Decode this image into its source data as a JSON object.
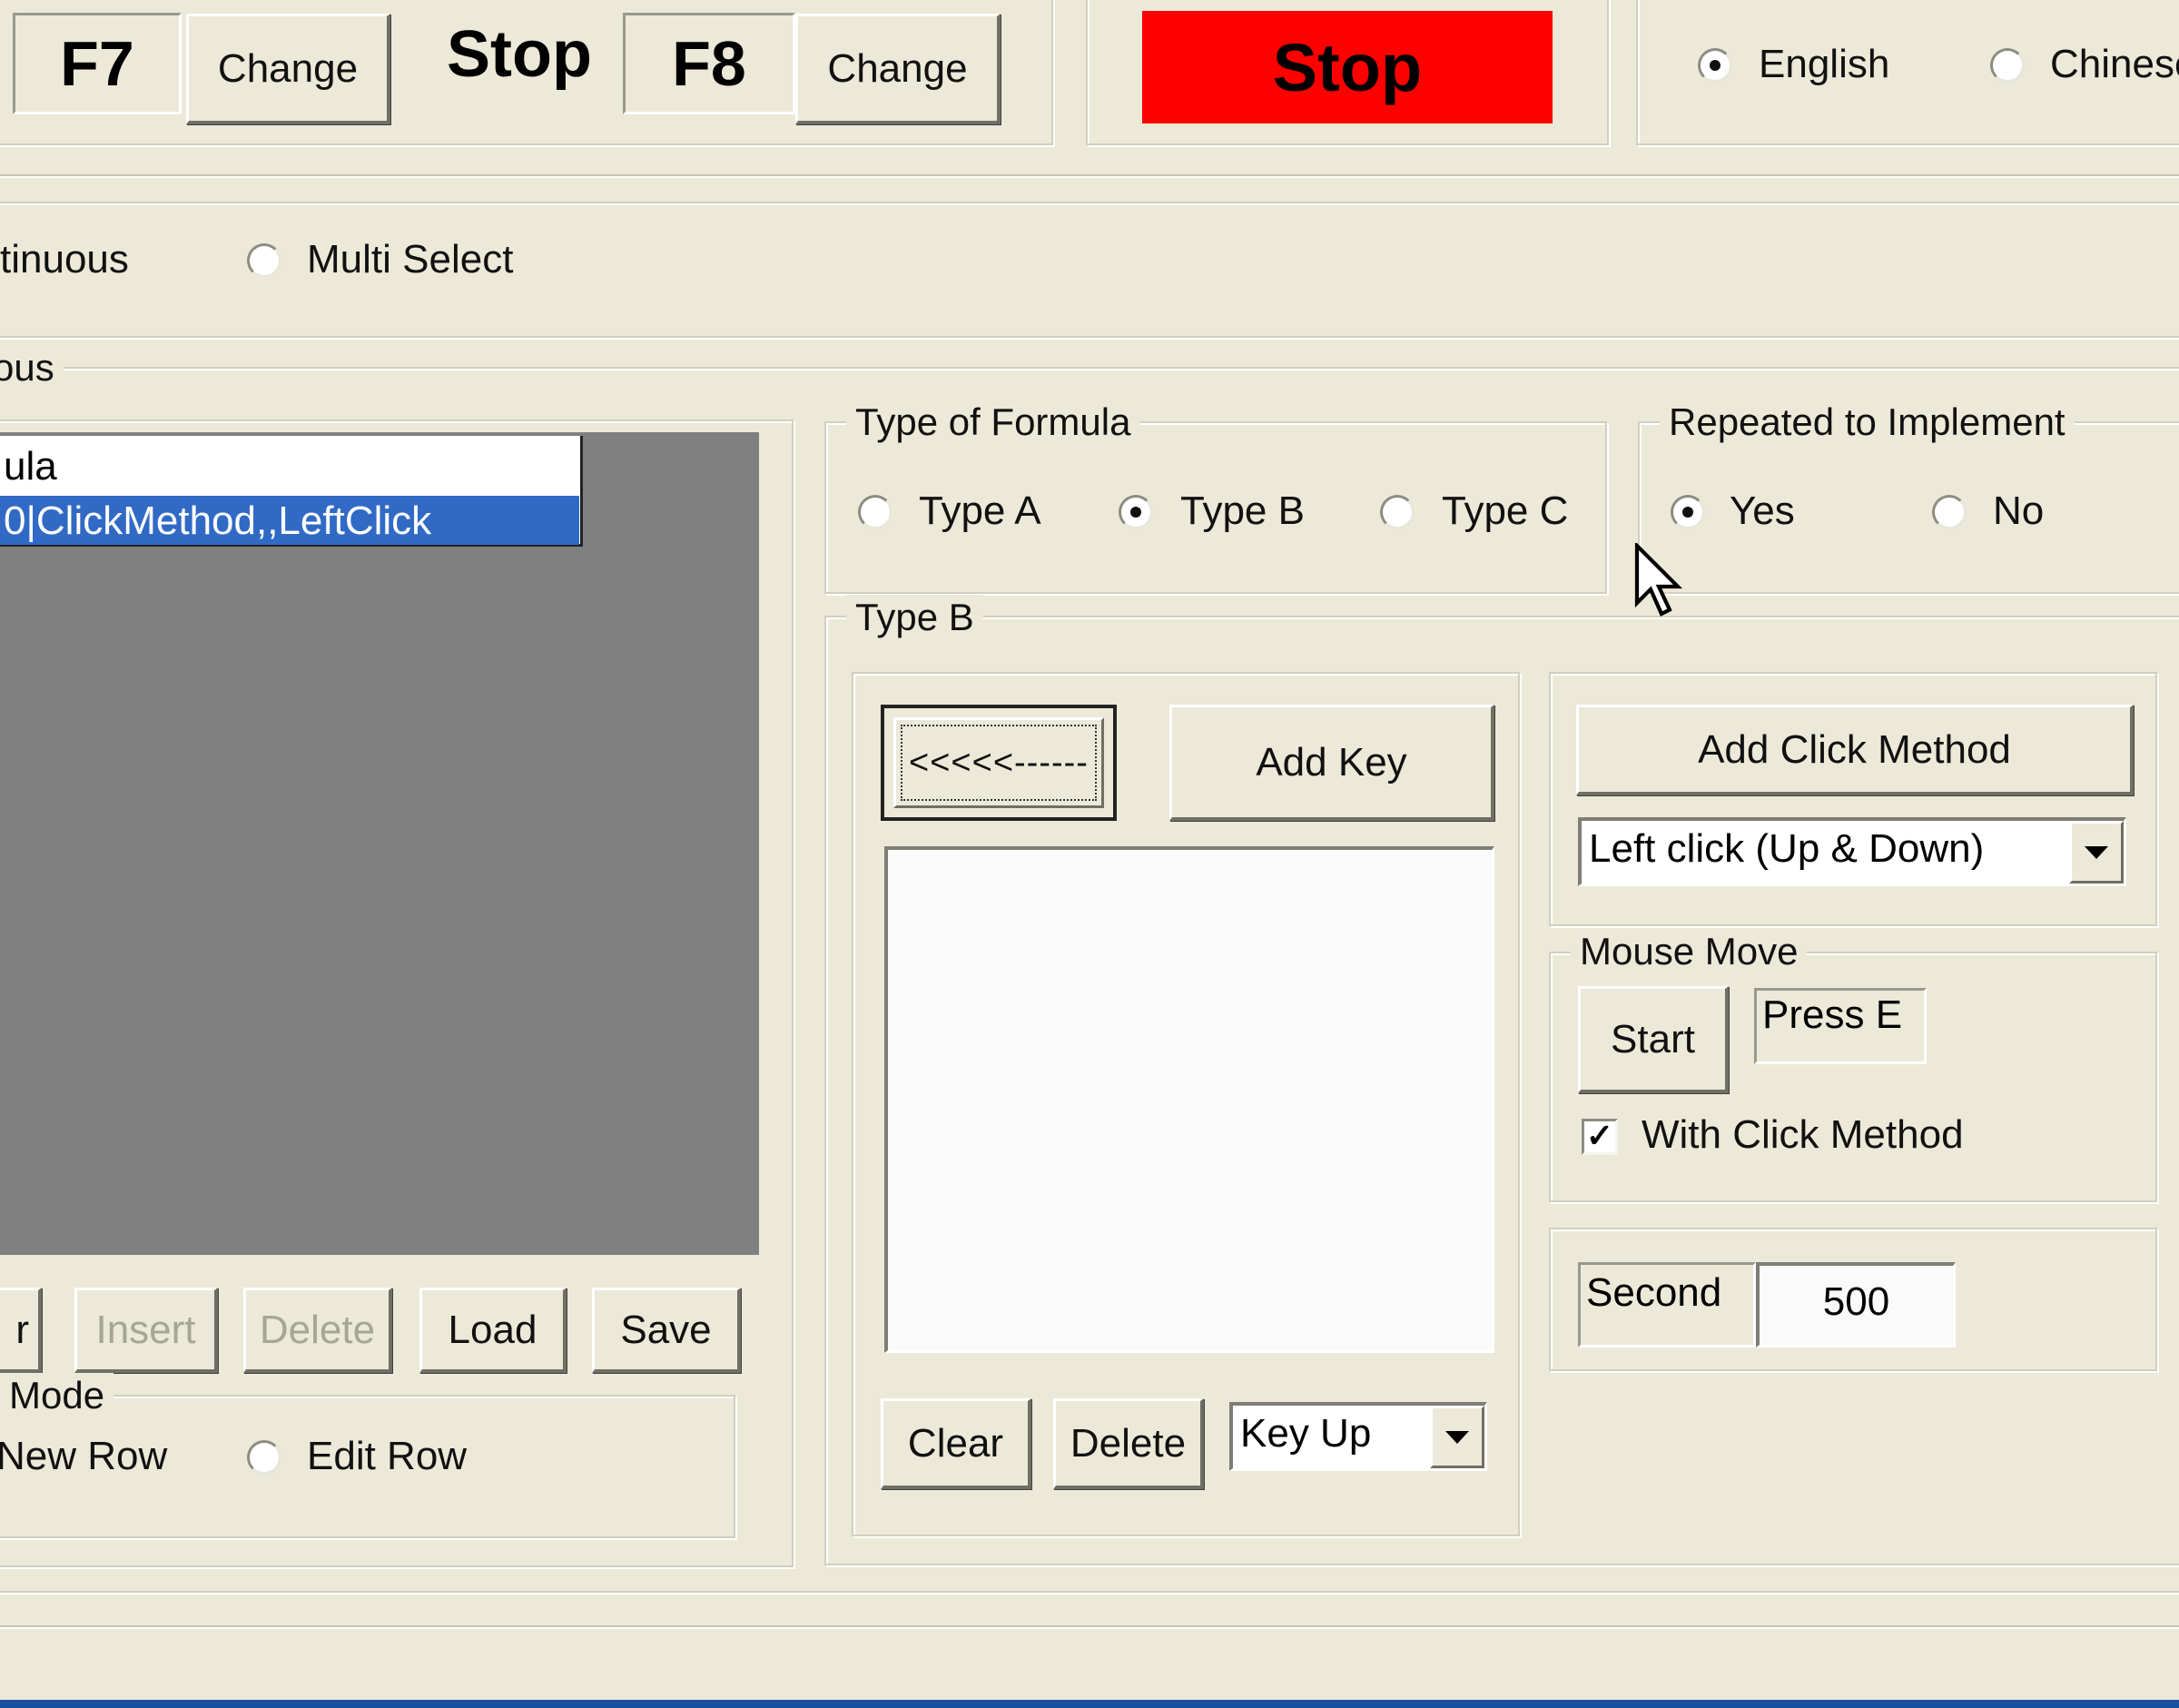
{
  "hotkeys": {
    "start_key": "F7",
    "start_change": "Change",
    "stop_label": "Stop",
    "stop_key": "F8",
    "stop_change": "Change"
  },
  "stop_button": {
    "label": "Stop",
    "color": "#ff0000"
  },
  "language": {
    "options": [
      "English",
      "Chinese"
    ],
    "selected": "English"
  },
  "mode": {
    "option_partial": "tinuous",
    "multi_select": "Multi Select"
  },
  "section_partial_title": "ous",
  "list": {
    "rows": [
      "ula",
      "0|ClickMethod,,LeftClick"
    ],
    "selected_index": 1,
    "selected_color": "#316ac5"
  },
  "list_buttons": {
    "partial": "r",
    "insert": "Insert",
    "delete": "Delete",
    "load": "Load",
    "save": "Save"
  },
  "edit_mode": {
    "title_partial": "Mode",
    "new_row_partial": "New Row",
    "edit_row": "Edit Row"
  },
  "formula": {
    "title": "Type of Formula",
    "options": [
      "Type A",
      "Type B",
      "Type C"
    ],
    "selected": "Type B"
  },
  "repeated": {
    "title": "Repeated to Implement",
    "options": [
      "Yes",
      "No"
    ],
    "selected": "Yes"
  },
  "type_b": {
    "title": "Type B",
    "arrow_button": "<<<<<------",
    "add_key": "Add Key",
    "clear": "Clear",
    "delete": "Delete",
    "key_select": "Key Up",
    "add_click_method": "Add Click Method",
    "click_select": "Left click (Up & Down)",
    "mouse_move": {
      "title": "Mouse Move",
      "start": "Start",
      "press_label": "Press E",
      "with_click": "With Click Method",
      "with_click_checked": true
    },
    "second_label": "Second",
    "second_value": "500"
  }
}
